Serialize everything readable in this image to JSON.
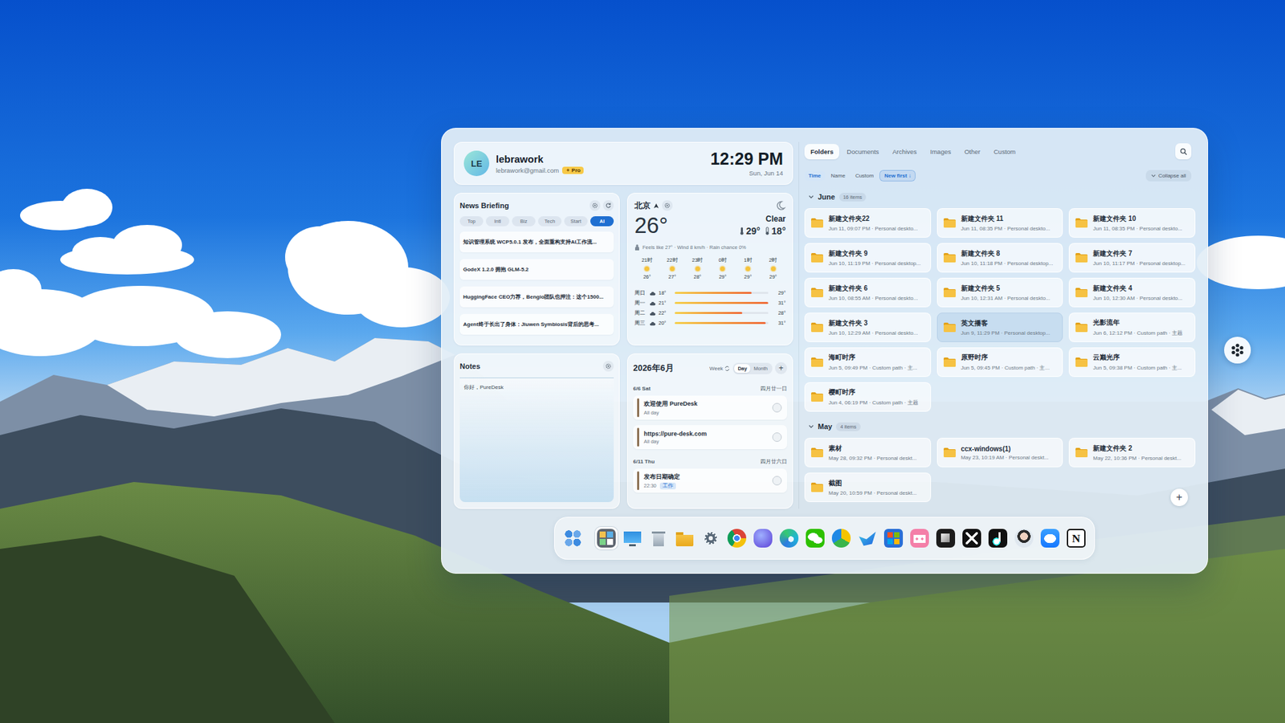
{
  "profile": {
    "avatar": "LE",
    "name": "lebrawork",
    "email": "lebrawork@gmail.com",
    "badge": {
      "icon": "✦",
      "label": "Pro"
    },
    "time": "12:29 PM",
    "date": "Sun, Jun 14"
  },
  "news": {
    "title": "News Briefing",
    "tabs": [
      {
        "label": "Top",
        "selected": false
      },
      {
        "label": "Intl",
        "selected": false
      },
      {
        "label": "Biz",
        "selected": false
      },
      {
        "label": "Tech",
        "selected": false
      },
      {
        "label": "Start",
        "selected": false
      },
      {
        "label": "AI",
        "selected": true
      }
    ],
    "items": [
      "知识管理系统 WCP5.0.1 发布，全面重构支持AI工作流...",
      "GodeX 1.2.0 拥抱 GLM-5.2",
      "HuggingFace CEO力荐，Bengio团队也押注：这个1500...",
      "Agent终于长出了身体：Jiuwen Symbiosis背后的思考..."
    ]
  },
  "weather": {
    "city": "北京",
    "temp": "26°",
    "condition": "Clear",
    "high": "29°",
    "low": "18°",
    "details": "Feels like 27° · Wind 8 km/h · Rain chance 0%",
    "hourly": [
      {
        "time": "21时",
        "temp": "26°"
      },
      {
        "time": "22时",
        "temp": "27°"
      },
      {
        "time": "23时",
        "temp": "28°"
      },
      {
        "time": "0时",
        "temp": "29°"
      },
      {
        "time": "1时",
        "temp": "29°"
      },
      {
        "time": "2时",
        "temp": "29°"
      }
    ],
    "daily": [
      {
        "day": "周日",
        "low": "18°",
        "high": "29°",
        "level": 0.82
      },
      {
        "day": "周一",
        "low": "21°",
        "high": "31°",
        "level": 1.0
      },
      {
        "day": "周二",
        "low": "22°",
        "high": "28°",
        "level": 0.72
      },
      {
        "day": "周三",
        "low": "20°",
        "high": "31°",
        "level": 0.97
      }
    ]
  },
  "notes": {
    "title": "Notes",
    "text": "你好，PureDesk"
  },
  "calendar": {
    "title": "2026年6月",
    "week": "Week",
    "views": [
      {
        "label": "Day",
        "selected": true
      },
      {
        "label": "Month",
        "selected": false
      }
    ],
    "add": "+",
    "days": [
      {
        "date": "6/6 Sat",
        "lunar": "四月廿一日",
        "events": [
          {
            "title": "欢迎使用 PureDesk",
            "time": "All day",
            "done": false
          },
          {
            "title": "https://pure-desk.com",
            "time": "All day",
            "done": false
          }
        ]
      },
      {
        "date": "6/11 Thu",
        "lunar": "四月廿六日",
        "events": [
          {
            "title": "发布日期确定",
            "time": "22:30",
            "tag": "工作",
            "done": false
          }
        ]
      }
    ]
  },
  "files": {
    "tabs": [
      {
        "label": "Folders",
        "selected": true
      },
      {
        "label": "Documents",
        "selected": false
      },
      {
        "label": "Archives",
        "selected": false
      },
      {
        "label": "Images",
        "selected": false
      },
      {
        "label": "Other",
        "selected": false
      },
      {
        "label": "Custom",
        "selected": false
      }
    ],
    "sort": [
      {
        "label": "Time",
        "selected": true
      },
      {
        "label": "Name",
        "selected": false
      },
      {
        "label": "Custom",
        "selected": false
      }
    ],
    "order": {
      "label": "New first",
      "icon": "↓"
    },
    "collapse": "Collapse all",
    "add": "+",
    "groups": [
      {
        "label": "June",
        "count": "16 items",
        "expanded": true,
        "items": [
          {
            "name": "新建文件夹22",
            "meta": "Jun 11, 09:07 PM · Personal deskto...",
            "selected": false
          },
          {
            "name": "新建文件夹 11",
            "meta": "Jun 11, 08:35 PM · Personal deskto...",
            "selected": false
          },
          {
            "name": "新建文件夹 10",
            "meta": "Jun 11, 08:35 PM · Personal deskto...",
            "selected": false
          },
          {
            "name": "新建文件夹 9",
            "meta": "Jun 10, 11:19 PM · Personal desktop...",
            "selected": false
          },
          {
            "name": "新建文件夹 8",
            "meta": "Jun 10, 11:18 PM · Personal desktop...",
            "selected": false
          },
          {
            "name": "新建文件夹 7",
            "meta": "Jun 10, 11:17 PM · Personal desktop...",
            "selected": false
          },
          {
            "name": "新建文件夹 6",
            "meta": "Jun 10, 08:55 AM · Personal deskto...",
            "selected": false
          },
          {
            "name": "新建文件夹 5",
            "meta": "Jun 10, 12:31 AM · Personal deskto...",
            "selected": false
          },
          {
            "name": "新建文件夹 4",
            "meta": "Jun 10, 12:30 AM · Personal deskto...",
            "selected": false
          },
          {
            "name": "新建文件夹 3",
            "meta": "Jun 10, 12:29 AM · Personal deskto...",
            "selected": false
          },
          {
            "name": "英文播客",
            "meta": "Jun 9, 11:29 PM · Personal desktop...",
            "selected": true
          },
          {
            "name": "光影流年",
            "meta": "Jun 6, 12:12 PM · Custom path · 主题",
            "selected": false
          },
          {
            "name": "海町时序",
            "meta": "Jun 5, 09:49 PM · Custom path · 主...",
            "selected": false
          },
          {
            "name": "原野时序",
            "meta": "Jun 5, 09:45 PM · Custom path · 主...",
            "selected": false
          },
          {
            "name": "云巅光序",
            "meta": "Jun 5, 09:38 PM · Custom path · 主...",
            "selected": false
          },
          {
            "name": "樱町时序",
            "meta": "Jun 4, 06:19 PM · Custom path · 主题",
            "selected": false
          }
        ]
      },
      {
        "label": "May",
        "count": "4 items",
        "expanded": true,
        "items": [
          {
            "name": "素材",
            "meta": "May 28, 09:32 PM · Personal deskt...",
            "selected": false
          },
          {
            "name": "ccx-windows(1)",
            "meta": "May 23, 10:19 AM · Personal deskt...",
            "selected": false
          },
          {
            "name": "新建文件夹 2",
            "meta": "May 22, 10:36 PM · Personal deskt...",
            "selected": false
          },
          {
            "name": "截图",
            "meta": "May 20, 10:59 PM · Personal deskt...",
            "selected": false
          }
        ]
      }
    ]
  },
  "dock": [
    {
      "selected": false
    },
    {
      "selected": true
    },
    {
      "selected": false
    },
    {
      "selected": false
    },
    {
      "selected": false
    },
    {
      "selected": false
    },
    {
      "selected": false
    },
    {
      "selected": false
    },
    {
      "selected": false
    },
    {
      "selected": false
    },
    {
      "selected": false
    },
    {
      "selected": false
    },
    {
      "selected": false
    },
    {
      "selected": false
    },
    {
      "selected": false
    },
    {
      "selected": false
    },
    {
      "selected": false
    },
    {
      "selected": false
    },
    {
      "selected": false
    },
    {
      "selected": false,
      "glyph": "N"
    }
  ]
}
